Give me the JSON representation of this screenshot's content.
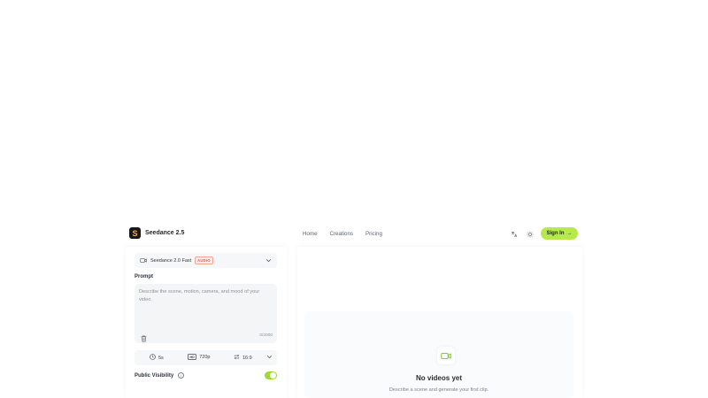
{
  "header": {
    "brand_logo": "S",
    "brand_name": "Seedance 2.5",
    "nav": [
      "Home",
      "Creations",
      "Pricing"
    ],
    "icons": [
      "translate-icon",
      "sun-icon"
    ],
    "signin_label": "Sign In",
    "signin_arrow": "→",
    "accent_color": "#b6ea4c"
  },
  "generator": {
    "model_name": "Seedance 2.0 Fast",
    "model_badge": "AUDIO",
    "prompt_label": "Prompt",
    "prompt_placeholder": "Describe the scene, motion, camera, and mood of your video.",
    "char_count": "0/2000",
    "duration": "5s",
    "resolution_badge": "HD",
    "resolution": "720p",
    "aspect_ratio": "16:9",
    "visibility_label": "Public Visibility",
    "visibility_on": true
  },
  "preview": {
    "empty_title": "No videos yet",
    "empty_subtitle": "Describe a scene and generate your first clip."
  }
}
